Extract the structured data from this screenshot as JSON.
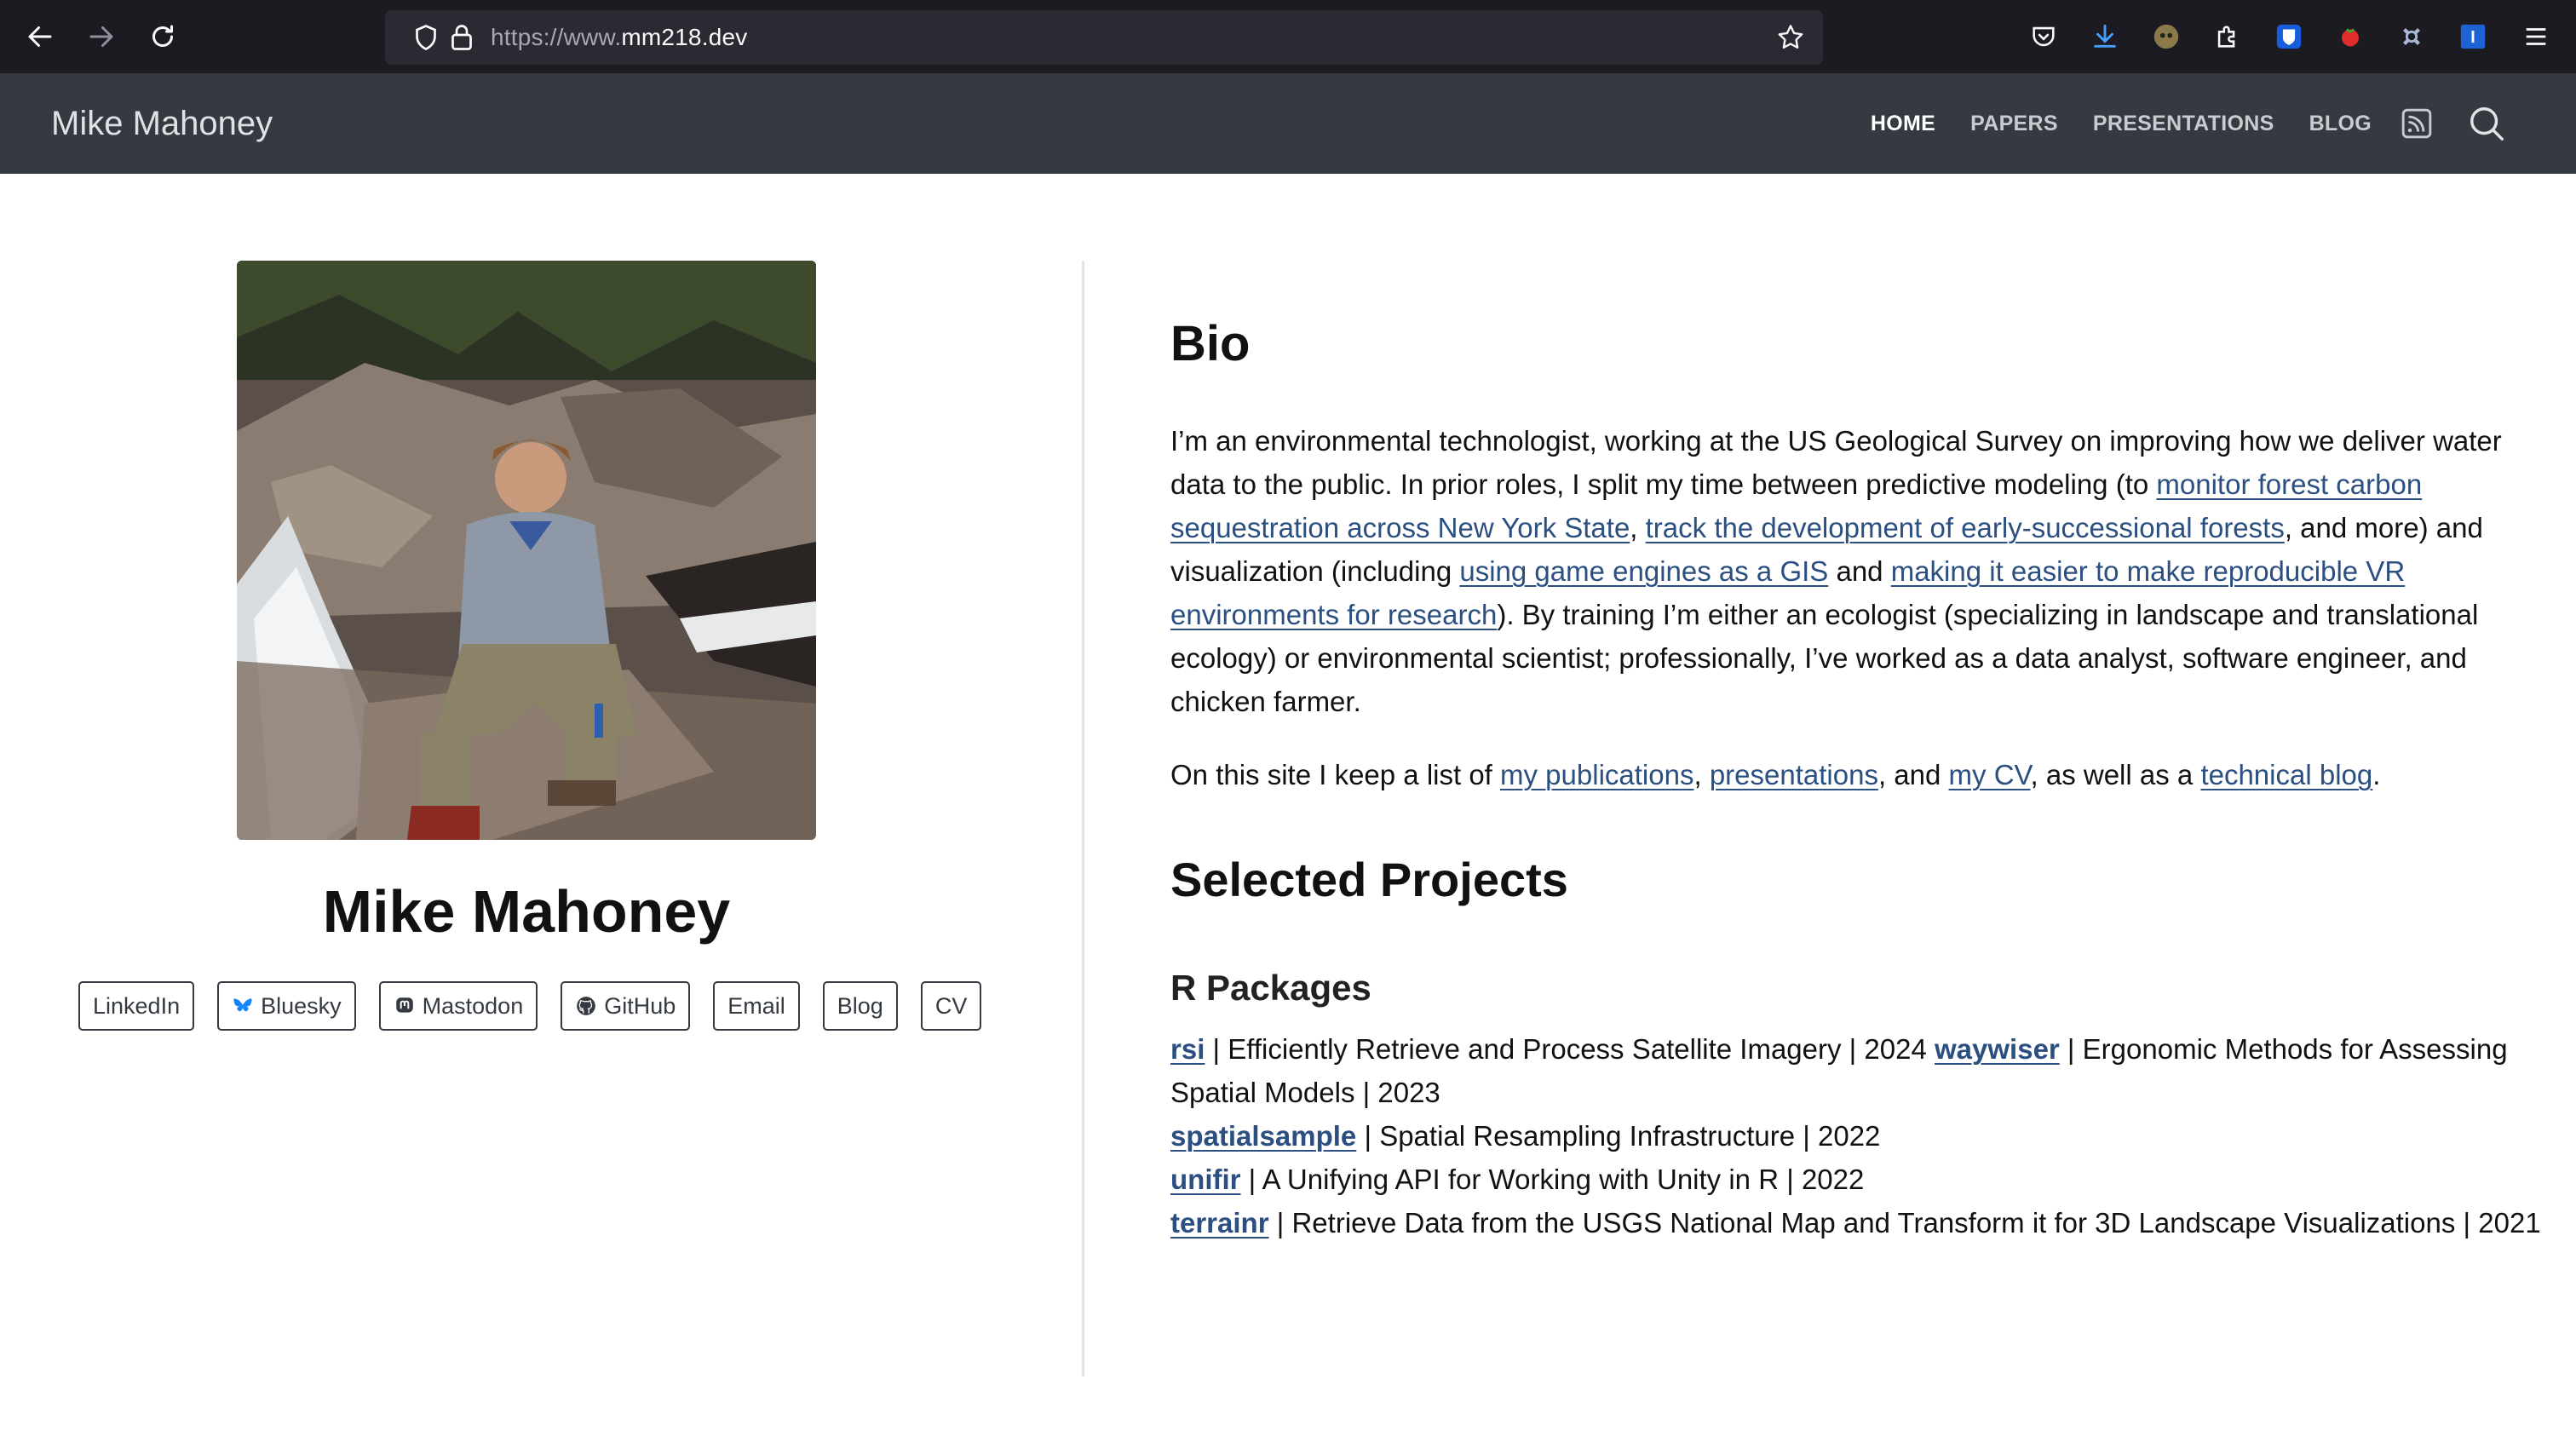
{
  "browser": {
    "url_scheme": "https://www.",
    "url_host": "mm218.dev"
  },
  "site": {
    "brand": "Mike Mahoney",
    "menu": [
      {
        "label": "HOME",
        "active": true
      },
      {
        "label": "PAPERS",
        "active": false
      },
      {
        "label": "PRESENTATIONS",
        "active": false
      },
      {
        "label": "BLOG",
        "active": false
      }
    ]
  },
  "profile": {
    "name": "Mike Mahoney",
    "links": [
      "LinkedIn",
      "Bluesky",
      "Mastodon",
      "GitHub",
      "Email",
      "Blog",
      "CV"
    ]
  },
  "bio": {
    "heading": "Bio",
    "p1_a": "I’m an environmental technologist, working at the US Geological Survey on improving how we deliver water data to the public. In prior roles, I split my time between predictive modeling (to ",
    "p1_link1": "monitor forest carbon sequestration across New York State",
    "p1_b": ", ",
    "p1_link2": "track the development of early-successional forests",
    "p1_c": ", and more) and visualization (including ",
    "p1_link3": "using game engines as a GIS",
    "p1_d": " and ",
    "p1_link4": "making it easier to make reproducible VR environments for research",
    "p1_e": "). By training I’m either an ecologist (specializing in landscape and translational ecology) or environmental scientist; professionally, I’ve worked as a data analyst, software engineer, and chicken farmer.",
    "p2_a": "On this site I keep a list of ",
    "p2_link1": "my publications",
    "p2_b": ", ",
    "p2_link2": "presentations",
    "p2_c": ", and ",
    "p2_link3": "my CV",
    "p2_d": ", as well as a ",
    "p2_link4": "technical blog",
    "p2_e": "."
  },
  "projects": {
    "heading": "Selected Projects",
    "subheading": "R Packages",
    "items": [
      {
        "name": "rsi",
        "desc": " | Efficiently Retrieve and Process Satellite Imagery | 2024 "
      },
      {
        "name": "waywiser",
        "desc": " | Ergonomic Methods for Assessing Spatial Models | 2023"
      },
      {
        "name": "spatialsample",
        "desc": " | Spatial Resampling Infrastructure | 2022"
      },
      {
        "name": "unifir",
        "desc": " | A Unifying API for Working with Unity in R | 2022"
      },
      {
        "name": "terrainr",
        "desc": " | Retrieve Data from the USGS National Map and Transform it for 3D Landscape Visualizations | 2021"
      }
    ]
  },
  "colors": {
    "chrome_bg": "#1c1b22",
    "navbar_bg": "#343a40",
    "link": "#2b4f80"
  }
}
